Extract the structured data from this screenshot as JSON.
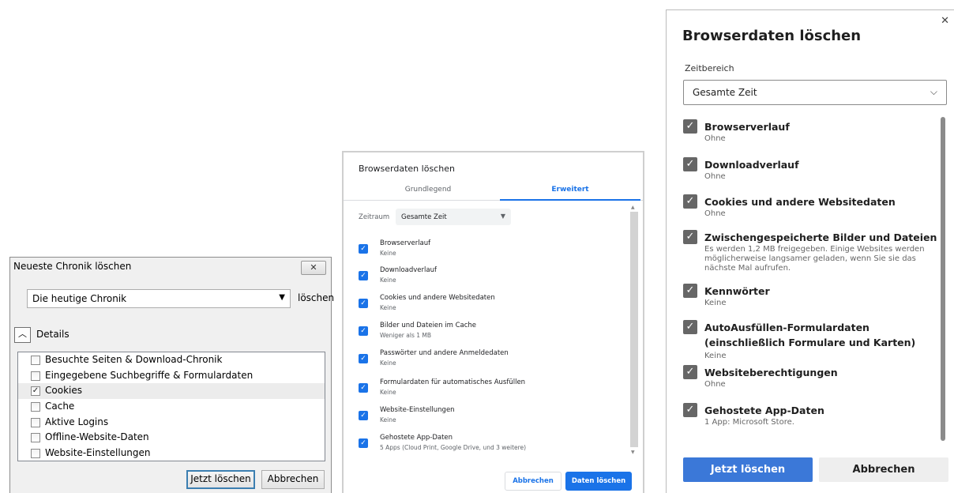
{
  "firefox": {
    "title": "Neueste Chronik löschen",
    "close_icon": "close-icon",
    "range_selected": "Die heutige Chronik",
    "range_suffix": "löschen",
    "details_label": "Details",
    "items": [
      {
        "label": "Besuchte Seiten & Download-Chronik",
        "checked": false
      },
      {
        "label": "Eingegebene Suchbegriffe & Formulardaten",
        "checked": false
      },
      {
        "label": "Cookies",
        "checked": true
      },
      {
        "label": "Cache",
        "checked": false
      },
      {
        "label": "Aktive Logins",
        "checked": false
      },
      {
        "label": "Offline-Website-Daten",
        "checked": false
      },
      {
        "label": "Website-Einstellungen",
        "checked": false
      }
    ],
    "clear_button": "Jetzt löschen",
    "cancel_button": "Abbrechen"
  },
  "chrome": {
    "title": "Browserdaten löschen",
    "tabs": {
      "basic": "Grundlegend",
      "advanced": "Erweitert"
    },
    "range_label": "Zeitraum",
    "range_selected": "Gesamte Zeit",
    "items": [
      {
        "label": "Browserverlauf",
        "sub": "Keine",
        "checked": true
      },
      {
        "label": "Downloadverlauf",
        "sub": "Keine",
        "checked": true
      },
      {
        "label": "Cookies und andere Websitedaten",
        "sub": "Keine",
        "checked": true
      },
      {
        "label": "Bilder und Dateien im Cache",
        "sub": "Weniger als 1 MB",
        "checked": true
      },
      {
        "label": "Passwörter und andere Anmeldedaten",
        "sub": "Keine",
        "checked": true
      },
      {
        "label": "Formulardaten für automatisches Ausfüllen",
        "sub": "Keine",
        "checked": true
      },
      {
        "label": "Website-Einstellungen",
        "sub": "Keine",
        "checked": true
      },
      {
        "label": "Gehostete App-Daten",
        "sub": "5 Apps (Cloud Print, Google Drive, und 3 weitere)",
        "checked": true
      }
    ],
    "cancel_button": "Abbrechen",
    "clear_button": "Daten löschen",
    "accent": "#1a73e8"
  },
  "edge": {
    "title": "Browserdaten löschen",
    "range_label": "Zeitbereich",
    "range_selected": "Gesamte Zeit",
    "items": [
      {
        "label": "Browserverlauf",
        "sub": "Ohne",
        "checked": true
      },
      {
        "label": "Downloadverlauf",
        "sub": "Ohne",
        "checked": true
      },
      {
        "label": "Cookies und andere Websitedaten",
        "sub": "Ohne",
        "checked": true
      },
      {
        "label": "Zwischengespeicherte Bilder und Dateien",
        "sub": "Es werden 1,2 MB freigegeben. Einige Websites werden möglicherweise langsamer geladen, wenn Sie sie das nächste Mal aufrufen.",
        "checked": true
      },
      {
        "label": "Kennwörter",
        "sub": "Keine",
        "checked": true
      },
      {
        "label": "AutoAusfüllen-Formulardaten (einschließlich Formulare und Karten)",
        "sub": "Keine",
        "checked": true
      },
      {
        "label": "Websiteberechtigungen",
        "sub": "Ohne",
        "checked": true
      },
      {
        "label": "Gehostete App-Daten",
        "sub": "1 App: Microsoft Store.",
        "checked": true
      }
    ],
    "clear_button": "Jetzt löschen",
    "cancel_button": "Abbrechen",
    "accent": "#3b78d8"
  }
}
